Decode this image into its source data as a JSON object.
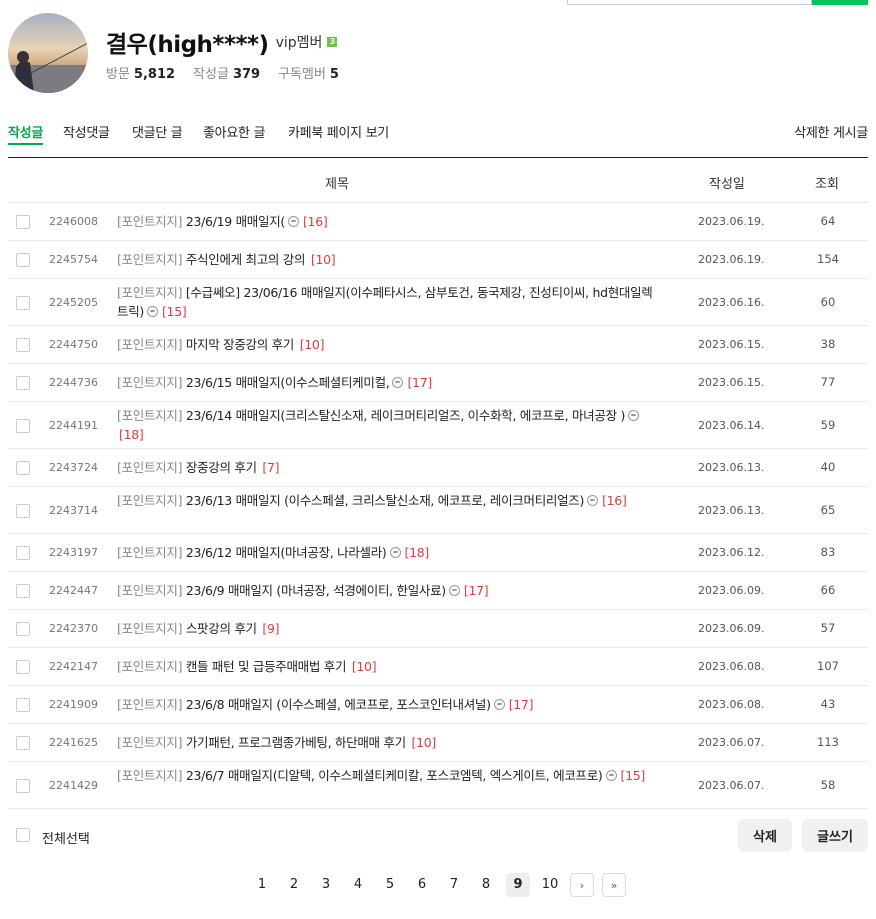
{
  "profile": {
    "name": "결우(high****)",
    "level_label": "vip멤버",
    "level_badge": "3",
    "visits_label": "방문",
    "visits": "5,812",
    "posts_label": "작성글",
    "posts": "379",
    "subs_label": "구독멤버",
    "subs": "5"
  },
  "tabs": [
    {
      "label": "작성글"
    },
    {
      "label": "작성댓글"
    },
    {
      "label": "댓글단 글"
    },
    {
      "label": "좋아요한 글"
    },
    {
      "label": "카페북 페이지 보기"
    }
  ],
  "deleted_posts_label": "삭제한 게시글",
  "columns": {
    "title": "제목",
    "date": "작성일",
    "views": "조회"
  },
  "rows": [
    {
      "num": "2246008",
      "cat": "[포인트지지]",
      "text": "23/6/19 매매일지(",
      "cmt": true,
      "count": "[16]",
      "date": "2023.06.19.",
      "views": "64"
    },
    {
      "num": "2245754",
      "cat": "[포인트지지]",
      "text": "주식인에게 최고의 강의",
      "cmt": false,
      "count": "[10]",
      "date": "2023.06.19.",
      "views": "154"
    },
    {
      "num": "2245205",
      "cat": "[포인트지지]",
      "text": "[수급쎄오] 23/06/16 매매일지(이수페타시스, 삼부토건, 동국제강, 진성티이씨, hd현대일렉트릭)",
      "cmt": true,
      "count": "[15]",
      "date": "2023.06.16.",
      "views": "60"
    },
    {
      "num": "2244750",
      "cat": "[포인트지지]",
      "text": "마지막 장중강의 후기",
      "cmt": false,
      "count": "[10]",
      "date": "2023.06.15.",
      "views": "38"
    },
    {
      "num": "2244736",
      "cat": "[포인트지지]",
      "text": "23/6/15 매매일지(이수스페셜티케미컬,",
      "cmt": true,
      "count": "[17]",
      "date": "2023.06.15.",
      "views": "77"
    },
    {
      "num": "2244191",
      "cat": "[포인트지지]",
      "text": "23/6/14 매매일지(크리스탈신소재, 레이크머티리얼즈, 이수화학, 에코프로, 마녀공장 )",
      "cmt": true,
      "count": "[18]",
      "date": "2023.06.14.",
      "views": "59"
    },
    {
      "num": "2243724",
      "cat": "[포인트지지]",
      "text": "장중강의 후기",
      "cmt": false,
      "count": "[7]",
      "date": "2023.06.13.",
      "views": "40"
    },
    {
      "num": "2243714",
      "cat": "[포인트지지]",
      "text": "23/6/13 매매일지 (이수스페셜, 크리스탈신소재, 에코프로, 레이크머티리얼즈)",
      "cmt": true,
      "count": "[16]",
      "date": "2023.06.13.",
      "views": "65"
    },
    {
      "num": "2243197",
      "cat": "[포인트지지]",
      "text": "23/6/12 매매일지(마녀공장, 나라셀라)",
      "cmt": true,
      "count": "[18]",
      "date": "2023.06.12.",
      "views": "83"
    },
    {
      "num": "2242447",
      "cat": "[포인트지지]",
      "text": "23/6/9 매매일지 (마녀공장, 석경에이티, 한일사료)",
      "cmt": true,
      "count": "[17]",
      "date": "2023.06.09.",
      "views": "66"
    },
    {
      "num": "2242370",
      "cat": "[포인트지지]",
      "text": "스팟강의 후기",
      "cmt": false,
      "count": "[9]",
      "date": "2023.06.09.",
      "views": "57"
    },
    {
      "num": "2242147",
      "cat": "[포인트지지]",
      "text": "캔들 패턴 및 급등주매매법 후기",
      "cmt": false,
      "count": "[10]",
      "date": "2023.06.08.",
      "views": "107"
    },
    {
      "num": "2241909",
      "cat": "[포인트지지]",
      "text": "23/6/8 매매일지 (이수스페셜, 에코프로, 포스코인터내셔널)",
      "cmt": true,
      "count": "[17]",
      "date": "2023.06.08.",
      "views": "43"
    },
    {
      "num": "2241625",
      "cat": "[포인트지지]",
      "text": "가기패턴, 프로그램종가베팅, 하단매매 후기",
      "cmt": false,
      "count": "[10]",
      "date": "2023.06.07.",
      "views": "113"
    },
    {
      "num": "2241429",
      "cat": "[포인트지지]",
      "text": "23/6/7 매매일지(디알텍, 이수스페셜티케미칼, 포스코엠텍, 엑스게이트, 에코프로)",
      "cmt": true,
      "count": "[15]",
      "date": "2023.06.07.",
      "views": "58"
    }
  ],
  "footer": {
    "select_all": "전체선택",
    "delete": "삭제",
    "write": "글쓰기"
  },
  "pagination": {
    "pages": [
      "1",
      "2",
      "3",
      "4",
      "5",
      "6",
      "7",
      "8",
      "9",
      "10"
    ],
    "current": "9",
    "next": "›",
    "last": "»"
  },
  "colors": {
    "accent": "#03c75a",
    "count": "#e03c3c"
  }
}
